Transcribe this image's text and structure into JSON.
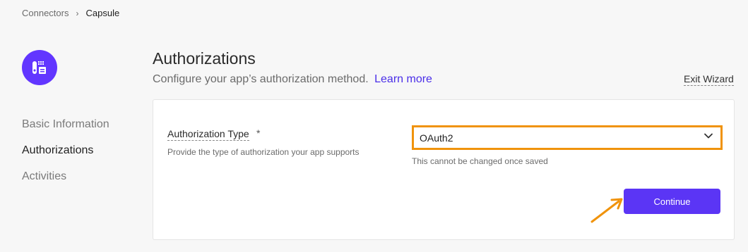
{
  "breadcrumb": {
    "parent": "Connectors",
    "separator": "›",
    "current": "Capsule"
  },
  "app": {
    "logo_icon": "capsule-app-icon",
    "accent_color": "#6236ff"
  },
  "sidebar": {
    "items": [
      {
        "label": "Basic Information",
        "active": false
      },
      {
        "label": "Authorizations",
        "active": true
      },
      {
        "label": "Activities",
        "active": false
      }
    ]
  },
  "header": {
    "title": "Authorizations",
    "subtitle": "Configure your app’s authorization method.",
    "learn_more": "Learn more",
    "exit_wizard": "Exit Wizard"
  },
  "form": {
    "auth_type_label": "Authorization Type",
    "required_marker": "*",
    "auth_type_help": "Provide the type of authorization your app supports",
    "auth_type_value": "OAuth2",
    "auth_type_note": "This cannot be changed once saved",
    "continue_label": "Continue",
    "highlight_color": "#f0930c",
    "button_color": "#5b35f5"
  }
}
